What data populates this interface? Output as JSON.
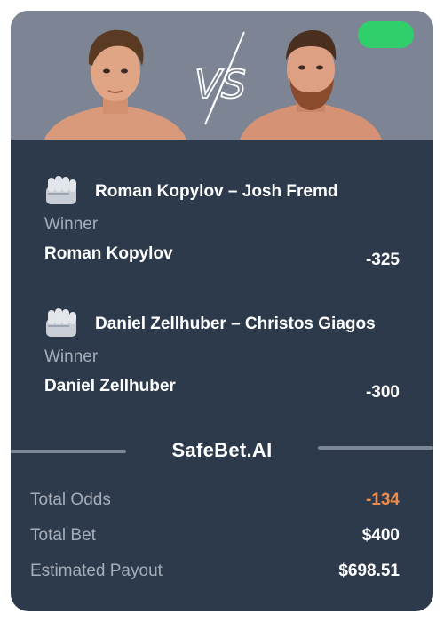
{
  "colors": {
    "card_bg": "#2c3a4b",
    "hero_bg": "#7d8595",
    "status_pill": "#2fd06b",
    "muted_text": "#a6adb8",
    "accent_odds": "#f08a4b"
  },
  "header": {
    "vs_label": "VS"
  },
  "bets": [
    {
      "icon": "fist-icon",
      "matchup": "Roman Kopylov – Josh Fremd",
      "market": "Winner",
      "pick": "Roman Kopylov",
      "odds": "-325"
    },
    {
      "icon": "fist-icon",
      "matchup": "Daniel Zellhuber – Christos Giagos",
      "market": "Winner",
      "pick": "Daniel Zellhuber",
      "odds": "-300"
    }
  ],
  "brand": "SafeBet.AI",
  "summary": {
    "total_odds_label": "Total Odds",
    "total_odds_value": "-134",
    "total_bet_label": "Total Bet",
    "total_bet_value": "$400",
    "payout_label": "Estimated Payout",
    "payout_value": "$698.51"
  }
}
